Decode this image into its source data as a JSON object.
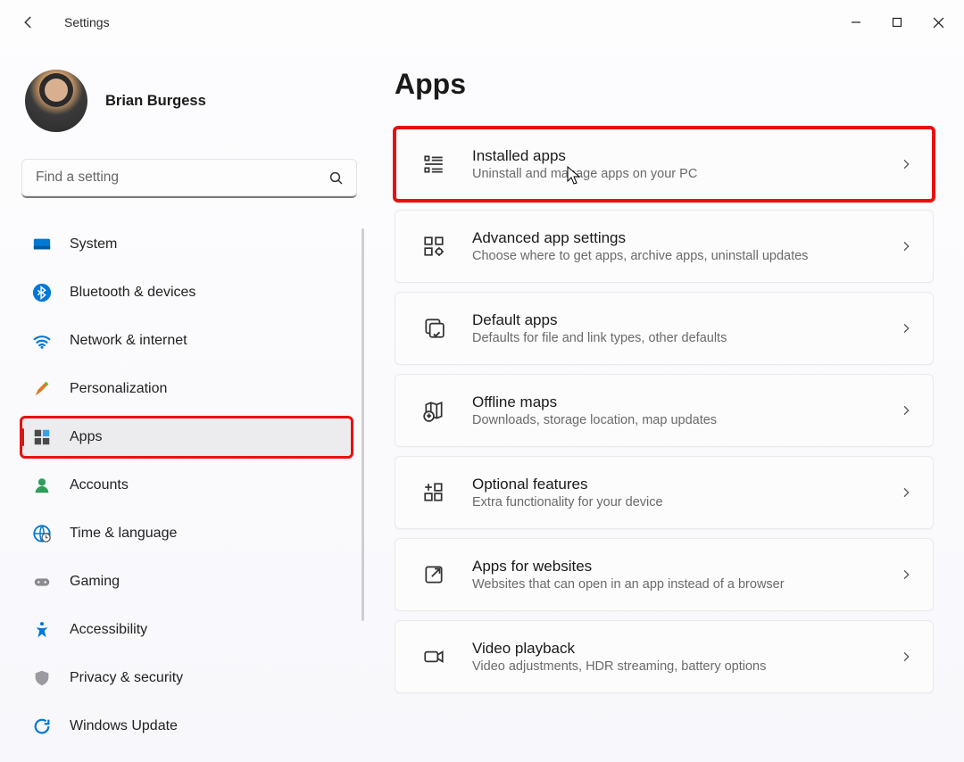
{
  "window": {
    "title": "Settings"
  },
  "profile": {
    "name": "Brian Burgess"
  },
  "search": {
    "placeholder": "Find a setting"
  },
  "sidebar": {
    "items": [
      {
        "id": "system",
        "label": "System",
        "icon": "system-icon",
        "active": false
      },
      {
        "id": "bluetooth",
        "label": "Bluetooth & devices",
        "icon": "bluetooth-icon",
        "active": false
      },
      {
        "id": "network",
        "label": "Network & internet",
        "icon": "wifi-icon",
        "active": false
      },
      {
        "id": "personalization",
        "label": "Personalization",
        "icon": "brush-icon",
        "active": false
      },
      {
        "id": "apps",
        "label": "Apps",
        "icon": "apps-icon",
        "active": true
      },
      {
        "id": "accounts",
        "label": "Accounts",
        "icon": "person-icon",
        "active": false
      },
      {
        "id": "time",
        "label": "Time & language",
        "icon": "globe-icon",
        "active": false
      },
      {
        "id": "gaming",
        "label": "Gaming",
        "icon": "gamepad-icon",
        "active": false
      },
      {
        "id": "accessibility",
        "label": "Accessibility",
        "icon": "accessibility-icon",
        "active": false
      },
      {
        "id": "privacy",
        "label": "Privacy & security",
        "icon": "shield-icon",
        "active": false
      },
      {
        "id": "update",
        "label": "Windows Update",
        "icon": "update-icon",
        "active": false
      }
    ]
  },
  "page": {
    "title": "Apps",
    "cards": [
      {
        "id": "installed",
        "title": "Installed apps",
        "subtitle": "Uninstall and manage apps on your PC",
        "icon": "list-icon",
        "highlight": true
      },
      {
        "id": "advanced",
        "title": "Advanced app settings",
        "subtitle": "Choose where to get apps, archive apps, uninstall updates",
        "icon": "grid-gear-icon",
        "highlight": false
      },
      {
        "id": "default",
        "title": "Default apps",
        "subtitle": "Defaults for file and link types, other defaults",
        "icon": "default-apps-icon",
        "highlight": false
      },
      {
        "id": "maps",
        "title": "Offline maps",
        "subtitle": "Downloads, storage location, map updates",
        "icon": "map-icon",
        "highlight": false
      },
      {
        "id": "optional",
        "title": "Optional features",
        "subtitle": "Extra functionality for your device",
        "icon": "grid-plus-icon",
        "highlight": false
      },
      {
        "id": "websites",
        "title": "Apps for websites",
        "subtitle": "Websites that can open in an app instead of a browser",
        "icon": "open-external-icon",
        "highlight": false
      },
      {
        "id": "video",
        "title": "Video playback",
        "subtitle": "Video adjustments, HDR streaming, battery options",
        "icon": "video-icon",
        "highlight": false
      }
    ]
  },
  "annotations": {
    "highlight_color": "#e81010",
    "sidebar_highlight_id": "apps",
    "card_highlight_id": "installed"
  }
}
